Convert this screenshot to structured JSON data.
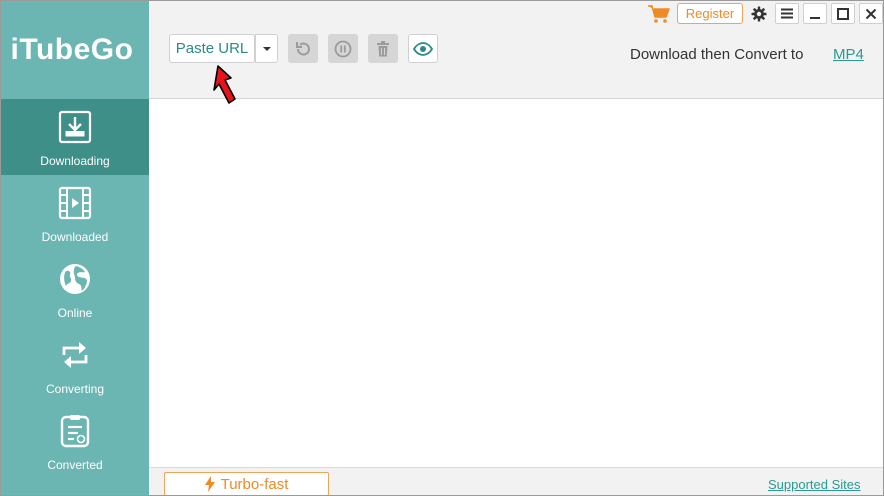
{
  "app": {
    "title": "iTubeGo"
  },
  "sidebar": {
    "items": [
      {
        "label": "Downloading",
        "icon": "download-tray-icon",
        "active": true
      },
      {
        "label": "Downloaded",
        "icon": "film-play-icon",
        "active": false
      },
      {
        "label": "Online",
        "icon": "globe-icon",
        "active": false
      },
      {
        "label": "Converting",
        "icon": "convert-arrows-icon",
        "active": false
      },
      {
        "label": "Converted",
        "icon": "converted-clipboard-icon",
        "active": false
      }
    ]
  },
  "toolbar": {
    "paste_url_label": "Paste URL",
    "convert_label": "Download then Convert to",
    "convert_format": "MP4",
    "register_label": "Register"
  },
  "footer": {
    "turbo_label": "Turbo-fast",
    "supported_sites_label": "Supported Sites"
  },
  "colors": {
    "sidebar": "#6bb5b2",
    "sidebar_active": "#3e8f88",
    "accent_orange": "#f08a24",
    "link_teal": "#2b9a94"
  }
}
